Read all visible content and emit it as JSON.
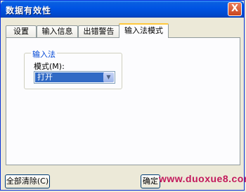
{
  "window": {
    "title": "数据有效性",
    "close_label": "X"
  },
  "tabs": [
    {
      "label": "设置"
    },
    {
      "label": "输入信息"
    },
    {
      "label": "出错警告"
    },
    {
      "label": "输入法模式"
    }
  ],
  "active_tab": 3,
  "group": {
    "label": "输入法",
    "mode_label": "模式(M):",
    "mode_value": "打开"
  },
  "buttons": {
    "clear_all": "全部清除(C)",
    "ok": "确定",
    "cancel": "取消"
  },
  "watermark": "www.duoxue8.com",
  "colors": {
    "title_bar": "#0054e3",
    "selection": "#316ac5",
    "group_label": "#0046d5"
  }
}
